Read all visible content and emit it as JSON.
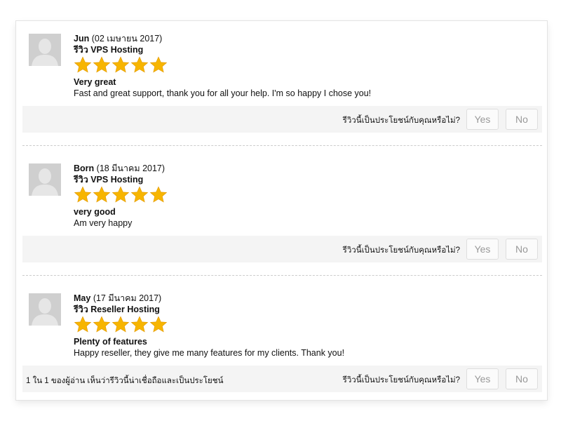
{
  "reviews": [
    {
      "author": "Jun",
      "date": "(02 เมษายน 2017)",
      "product_line": "รีวิว VPS Hosting",
      "rating": 5,
      "title": "Very great",
      "body": "Fast and great support, thank you for all your help. I'm so happy I chose you!",
      "help_question": "รีวิวนี้เป็นประโยชน์กับคุณหรือไม่?",
      "yes_label": "Yes",
      "no_label": "No"
    },
    {
      "author": "Born",
      "date": "(18 มีนาคม 2017)",
      "product_line": "รีวิว VPS Hosting",
      "rating": 5,
      "title": "very good",
      "body": "Am very happy",
      "help_question": "รีวิวนี้เป็นประโยชน์กับคุณหรือไม่?",
      "yes_label": "Yes",
      "no_label": "No"
    },
    {
      "author": "May",
      "date": "(17 มีนาคม 2017)",
      "product_line": "รีวิว Reseller Hosting",
      "rating": 5,
      "title": "Plenty of features",
      "body": "Happy reseller, they give me many features for my clients. Thank you!",
      "help_question": "รีวิวนี้เป็นประโยชน์กับคุณหรือไม่?",
      "yes_label": "Yes",
      "no_label": "No",
      "helpful_count": "1 ใน 1 ของผู้อ่าน เห็นว่ารีวิวนี้น่าเชื่อถือและเป็นประโยชน์"
    }
  ],
  "colors": {
    "star_fill": "#f7b500",
    "avatar_bg": "#cfcfcf",
    "helpbar_bg": "#f4f4f4",
    "button_text": "#999999"
  },
  "icons": {
    "avatar": "default-user-avatar-icon",
    "star": "star-icon"
  }
}
